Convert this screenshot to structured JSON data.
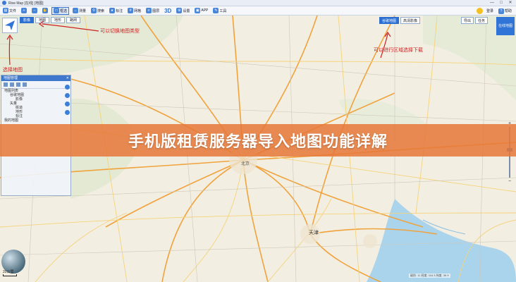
{
  "window": {
    "title": "Rive Map [在线] [地图]",
    "controls": [
      "—",
      "□",
      "✕"
    ]
  },
  "toolbar": {
    "items": [
      {
        "icon": "folder-icon",
        "label": "文件"
      },
      {
        "icon": "zoom-in-icon",
        "label": ""
      },
      {
        "icon": "zoom-out-icon",
        "label": ""
      },
      {
        "icon": "hand-icon",
        "label": ""
      },
      {
        "icon": "select-icon",
        "label": "框选"
      },
      {
        "icon": "measure-icon",
        "label": "测量"
      },
      {
        "icon": "search-icon",
        "label": "搜索"
      },
      {
        "icon": "pin-icon",
        "label": "标注"
      },
      {
        "icon": "grid-icon",
        "label": "网格"
      },
      {
        "icon": "layer-icon",
        "label": "图层"
      },
      {
        "icon": "3d-icon",
        "label": "3D"
      },
      {
        "icon": "gear-icon",
        "label": "设置"
      },
      {
        "icon": "app-icon",
        "label": "APP"
      },
      {
        "icon": "tool-icon",
        "label": "工具"
      }
    ],
    "right": {
      "user_label": "登录",
      "help_label": "帮助"
    }
  },
  "map": {
    "layer_tabs": [
      "影像",
      "地图",
      "地形",
      "路网"
    ],
    "right_buttons": [
      "谷歌地图",
      "高清影像",
      "导出",
      "任务"
    ],
    "corner_button": "在线地图",
    "cities": {
      "tianjin": "天津",
      "beijing": "北京"
    },
    "annotations": {
      "top": "可以切换地图类型",
      "right": "可以进行区域选择下载",
      "left": "选择地图"
    },
    "panel": {
      "title": "地图管理",
      "items": [
        {
          "label": "地图列表",
          "level": 0
        },
        {
          "label": "谷歌地图",
          "level": 1
        },
        {
          "label": "影像",
          "level": 2
        },
        {
          "label": "矢量",
          "level": 1
        },
        {
          "label": "街道",
          "level": 2
        },
        {
          "label": "地形",
          "level": 2
        },
        {
          "label": "标注",
          "level": 2
        },
        {
          "label": "我的地图",
          "level": 0
        }
      ]
    },
    "scale_label": "20公里",
    "status_text": "级别: 11   经度: 116.3   纬度: 39.9"
  },
  "banner": {
    "title": "手机版租赁服务器导入地图功能详解"
  }
}
